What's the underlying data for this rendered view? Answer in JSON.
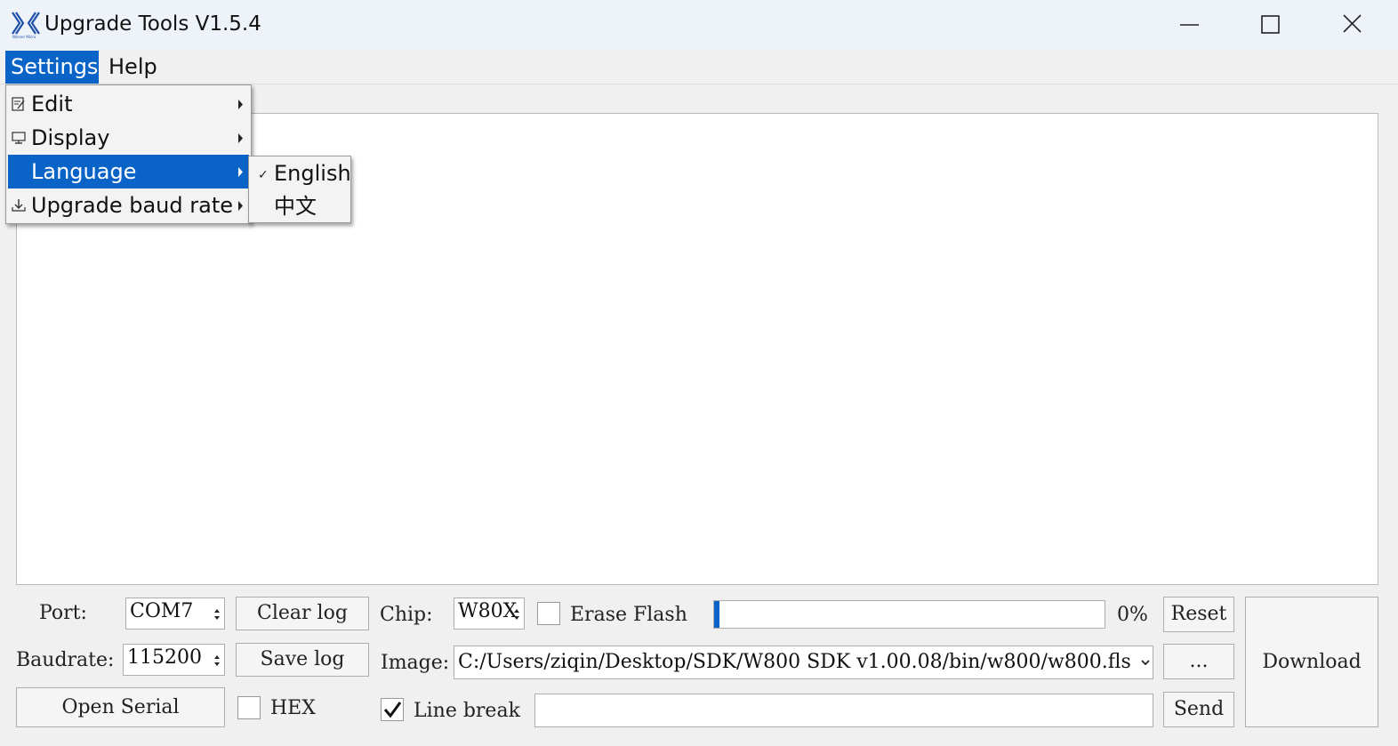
{
  "window": {
    "title": "Upgrade Tools V1.5.4",
    "logo_text": "Winner Micro"
  },
  "menubar": {
    "items": [
      {
        "label": "Settings",
        "active": true
      },
      {
        "label": "Help"
      }
    ]
  },
  "settings_menu": {
    "items": [
      {
        "label": "Edit",
        "icon": "edit-icon",
        "has_submenu": true
      },
      {
        "label": "Display",
        "icon": "monitor-icon",
        "has_submenu": true
      },
      {
        "label": "Language",
        "icon": "",
        "has_submenu": true,
        "highlighted": true
      },
      {
        "label": "Upgrade baud rate",
        "icon": "download-icon",
        "has_submenu": true
      }
    ]
  },
  "language_submenu": {
    "items": [
      {
        "label": "English",
        "checked": true
      },
      {
        "label": "中文",
        "checked": false
      }
    ]
  },
  "controls": {
    "port_label": "Port:",
    "port_value": "COM7",
    "baudrate_label": "Baudrate:",
    "baudrate_value": "115200",
    "clear_log": "Clear log",
    "save_log": "Save log",
    "open_serial": "Open Serial",
    "hex_label": "HEX",
    "hex_checked": false,
    "chip_label": "Chip:",
    "chip_value": "W80X",
    "erase_flash_label": "Erase Flash",
    "erase_flash_checked": false,
    "progress_percent": 0,
    "progress_text": "0%",
    "reset": "Reset",
    "image_label": "Image:",
    "image_path": "C:/Users/ziqin/Desktop/SDK/W800 SDK v1.00.08/bin/w800/w800.fls",
    "browse": "...",
    "download": "Download",
    "line_break_label": "Line break",
    "line_break_checked": true,
    "send": "Send",
    "send_text": ""
  },
  "colors": {
    "menu_highlight": "#0a64c8",
    "progress_fill": "#0a64c8",
    "titlebar_bg": "#eef3fa"
  }
}
